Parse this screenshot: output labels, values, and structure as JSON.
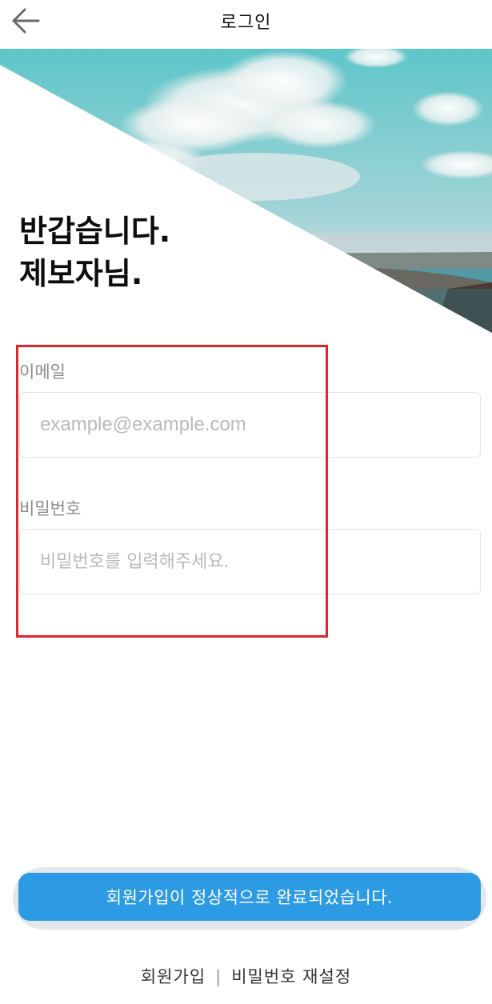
{
  "header": {
    "title": "로그인",
    "back_icon": "arrow-left-icon"
  },
  "hero": {
    "image": "sky-clouds-sea-photo",
    "greeting_line1": "반갑습니다.",
    "greeting_line2": "제보자님."
  },
  "form": {
    "email_label": "이메일",
    "email_placeholder": "example@example.com",
    "email_value": "",
    "password_label": "비밀번호",
    "password_placeholder": "비밀번호를 입력해주세요.",
    "password_value": ""
  },
  "button": {
    "label": "회원가입이 정상적으로 완료되었습니다.",
    "color": "#2d9be4"
  },
  "footer": {
    "signup_link": "회원가입",
    "separator": "|",
    "reset_link": "비밀번호 재설정"
  },
  "colors": {
    "highlight_border": "#e3242b",
    "label_text": "#8a8a8a"
  }
}
